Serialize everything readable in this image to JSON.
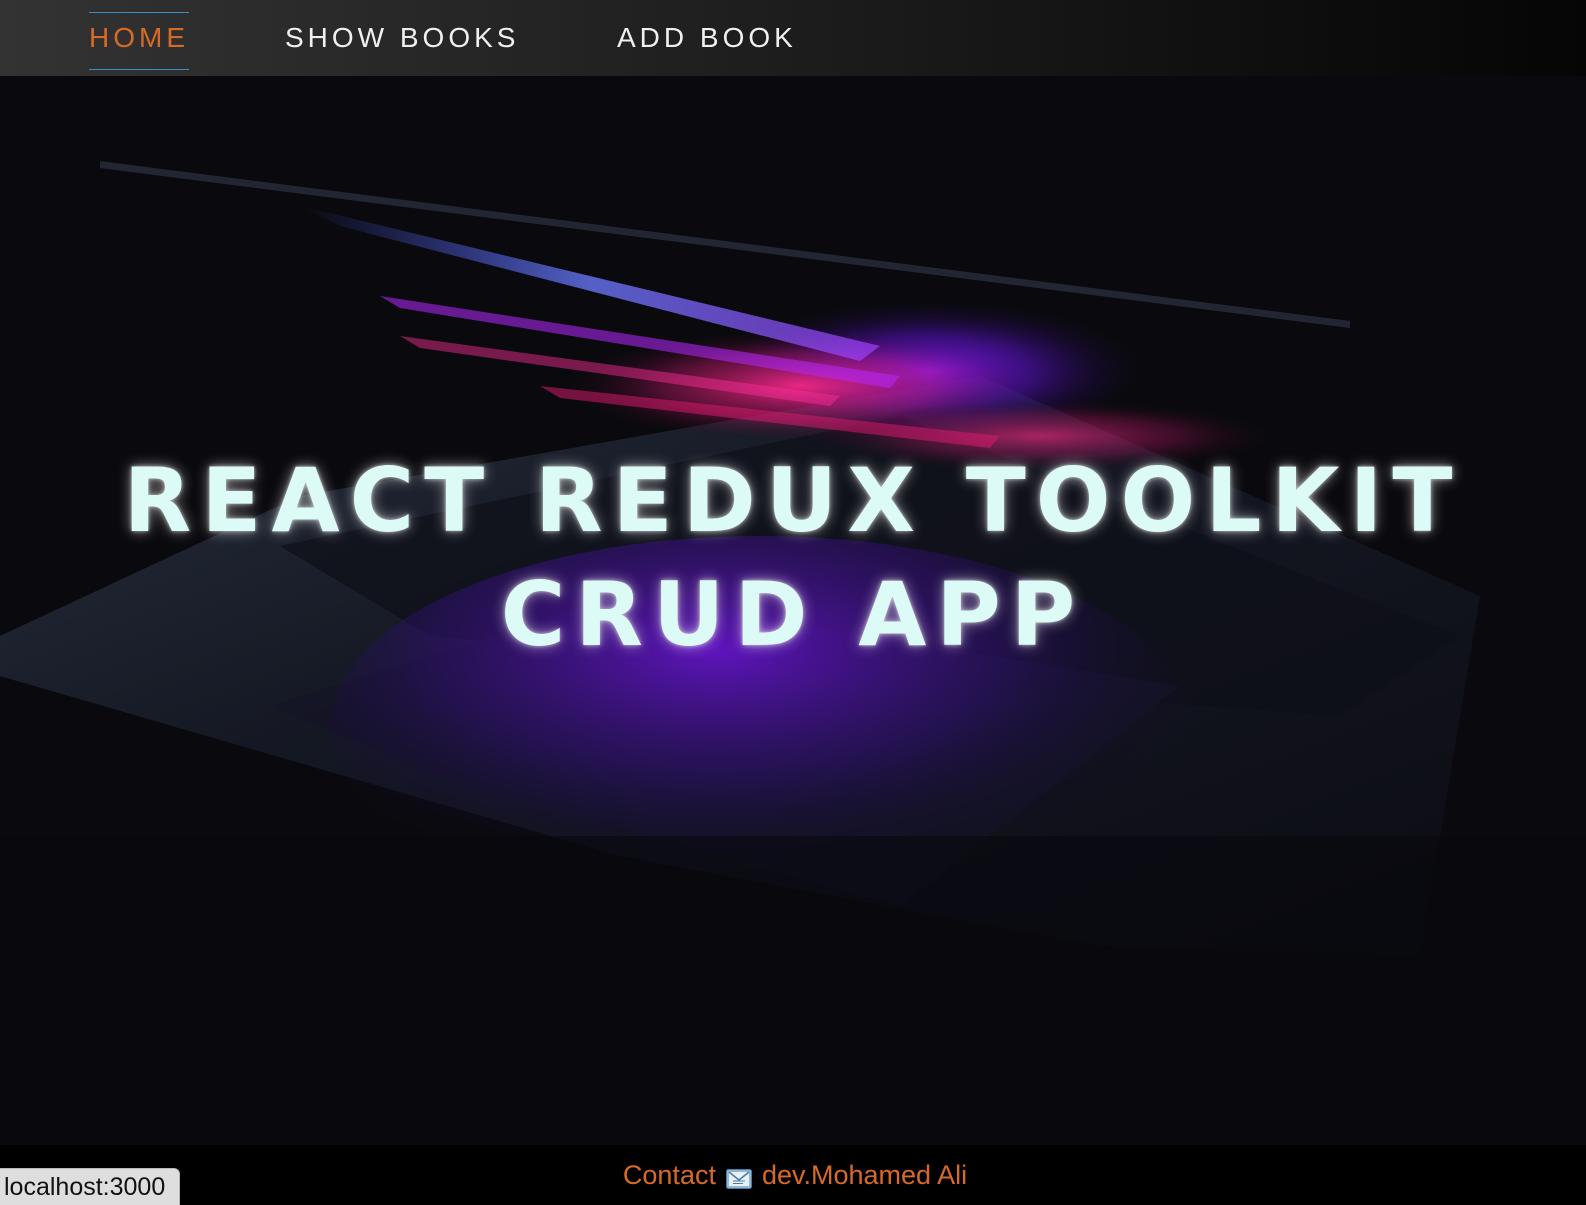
{
  "nav": {
    "items": [
      {
        "label": "HOME",
        "active": true
      },
      {
        "label": "SHOW BOOKS",
        "active": false
      },
      {
        "label": "ADD BOOK",
        "active": false
      }
    ]
  },
  "hero": {
    "title_line1": "REACT REDUX TOOLKIT",
    "title_line2": "CRUD APP"
  },
  "footer": {
    "contact_label": "Contact",
    "contact_icon": "envelope-icon",
    "author": "dev.Mohamed Ali"
  },
  "status_bar": {
    "url": "localhost:3000"
  },
  "colors": {
    "accent": "#d86a27",
    "active_underline": "#3c8fc2",
    "title": "#dcfaf6",
    "background": "#0b0b0e"
  }
}
